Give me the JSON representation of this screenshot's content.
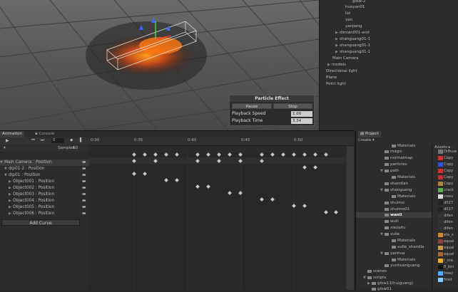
{
  "hierarchy": {
    "items": [
      {
        "label": "glow-2",
        "indent": 2
      },
      {
        "label": "huoyan01",
        "indent": 2
      },
      {
        "label": "lizi",
        "indent": 2
      },
      {
        "label": "yan",
        "indent": 2
      },
      {
        "label": "yanjiang",
        "indent": 2
      },
      {
        "label": "dimian001-and",
        "indent": 1,
        "arrow": true
      },
      {
        "label": "shanguang01-1",
        "indent": 1,
        "arrow": true
      },
      {
        "label": "shanguang01-1",
        "indent": 1,
        "arrow": true
      },
      {
        "label": "shanguang01-1",
        "indent": 1,
        "arrow": true
      },
      {
        "label": "Main Camera",
        "indent": 0
      },
      {
        "label": "models",
        "indent": -1,
        "arrow": true
      },
      {
        "label": "Directional light",
        "indent": -2
      },
      {
        "label": "Plane",
        "indent": -2
      },
      {
        "label": "Point light",
        "indent": -2
      }
    ]
  },
  "particle_effect": {
    "title": "Particle Effect",
    "pause": "Pause",
    "stop": "Stop",
    "speed_label": "Playback Speed",
    "speed_value": "1.00",
    "time_label": "Playback Time",
    "time_value": "3.34"
  },
  "animation": {
    "tab_animation": "Animation",
    "tab_console": "Console",
    "frame": "0",
    "samples_label": "Samples",
    "samples_value": "60",
    "ticks": [
      "0:00",
      "0:35",
      "0:40",
      "0:45",
      "0:50"
    ],
    "tracks": [
      "Main Camera : Position",
      "dip01-2 : Position",
      "dip01 : Position",
      "Object001 : Position",
      "Object002 : Position",
      "Object003 : Position",
      "Object004 : Position",
      "Object005 : Position",
      "Object006 : Position"
    ],
    "add_curve": "Add Curve"
  },
  "project": {
    "tab": "Project",
    "create": "Create",
    "assets_label": "Assets",
    "items": [
      {
        "label": "Materials",
        "indent": 2
      },
      {
        "label": "magic",
        "indent": 1
      },
      {
        "label": "normalmap",
        "indent": 1
      },
      {
        "label": "particles",
        "indent": 1
      },
      {
        "label": "path",
        "indent": 1
      },
      {
        "label": "Materials",
        "indent": 2
      },
      {
        "label": "shandian",
        "indent": 1
      },
      {
        "label": "shanguang",
        "indent": 1
      },
      {
        "label": "Materials",
        "indent": 2
      },
      {
        "label": "shuimo",
        "indent": 1
      },
      {
        "label": "shuimo01",
        "indent": 1
      },
      {
        "label": "wanli",
        "indent": 1
      },
      {
        "label": "wuti",
        "indent": 1
      },
      {
        "label": "xiezaitu",
        "indent": 1
      },
      {
        "label": "xulie",
        "indent": 1
      },
      {
        "label": "Materials",
        "indent": 2
      },
      {
        "label": "xulie_shandia",
        "indent": 2
      },
      {
        "label": "yanhua",
        "indent": 1
      },
      {
        "label": "Materials",
        "indent": 2
      },
      {
        "label": "yunhuanguang",
        "indent": 1
      },
      {
        "label": "scenes",
        "indent": 0
      },
      {
        "label": "scripts",
        "indent": 0
      },
      {
        "label": "glow11(huiguang)",
        "indent": 1
      },
      {
        "label": "glow01",
        "indent": 1
      }
    ],
    "assets": [
      "Diffuse",
      "Copy",
      "Copy",
      "Copy",
      "Copy",
      "Copy",
      "crack",
      "cresc",
      "d027",
      "d027",
      "difen",
      "difen",
      "difen",
      "efa_x",
      "equal",
      "equal",
      "equal",
      "f_ora",
      "fl_bin",
      "freez",
      "frost"
    ]
  }
}
